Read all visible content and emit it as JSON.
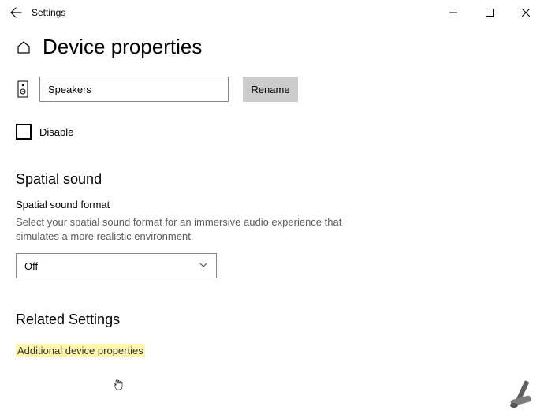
{
  "window": {
    "title": "Settings"
  },
  "page": {
    "title": "Device properties"
  },
  "device": {
    "name_value": "Speakers",
    "rename_label": "Rename"
  },
  "disable": {
    "label": "Disable",
    "checked": false
  },
  "spatial": {
    "section_title": "Spatial sound",
    "format_label": "Spatial sound format",
    "format_desc": "Select your spatial sound format for an immersive audio experience that simulates a more realistic environment.",
    "selected": "Off"
  },
  "related": {
    "section_title": "Related Settings",
    "link": "Additional device properties"
  }
}
